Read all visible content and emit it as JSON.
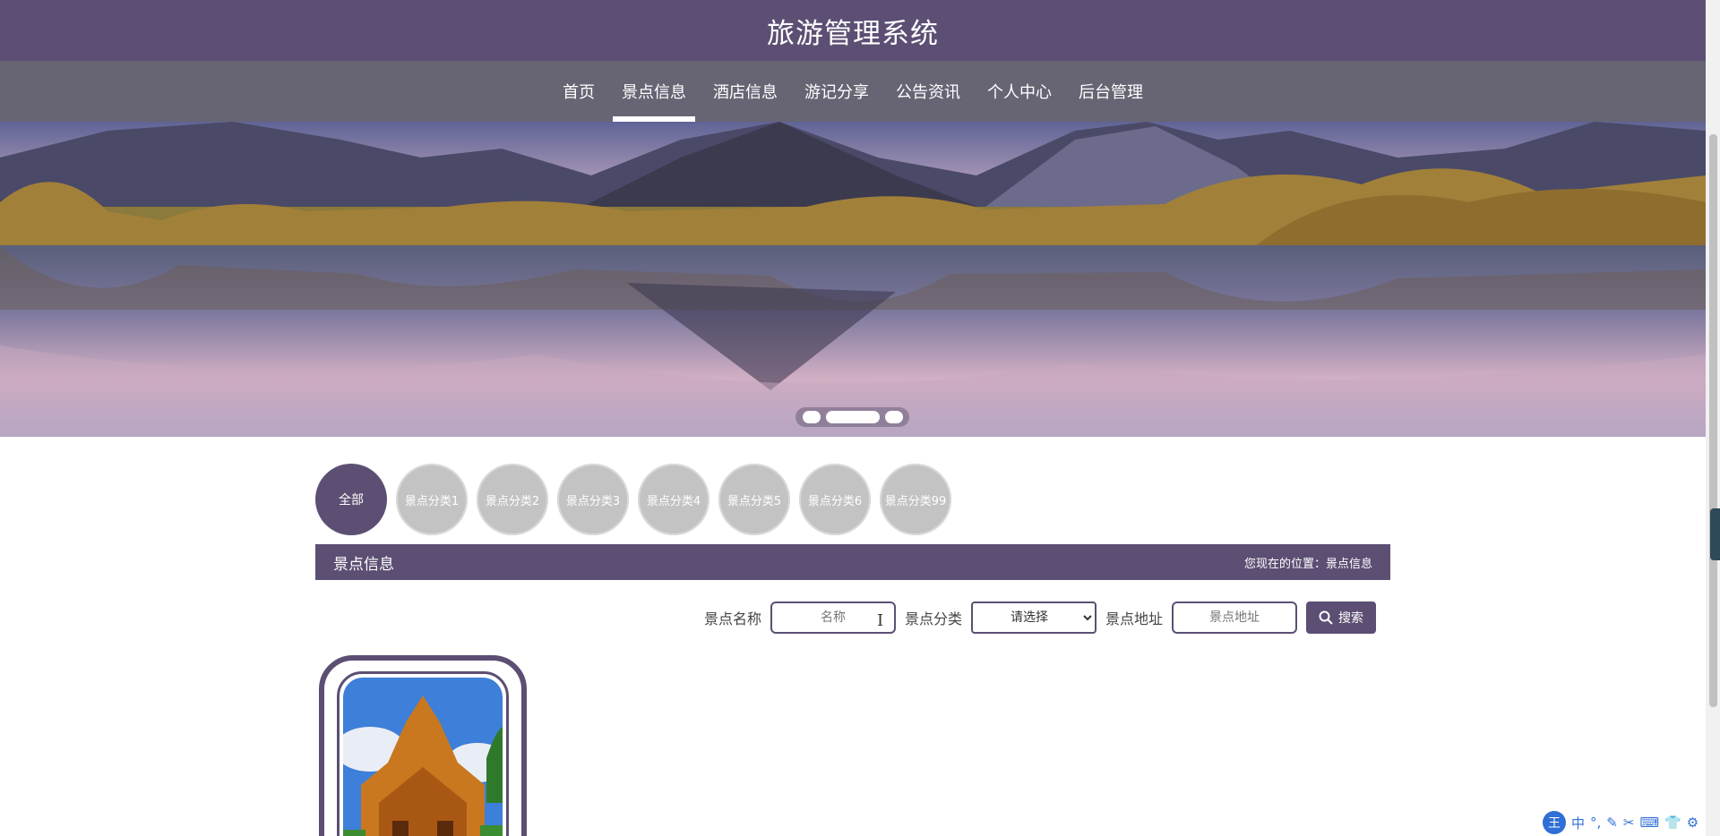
{
  "header": {
    "title": "旅游管理系统"
  },
  "nav": {
    "items": [
      {
        "label": "首页"
      },
      {
        "label": "景点信息",
        "active": true
      },
      {
        "label": "酒店信息"
      },
      {
        "label": "游记分享"
      },
      {
        "label": "公告资讯"
      },
      {
        "label": "个人中心"
      },
      {
        "label": "后台管理"
      }
    ]
  },
  "banner": {
    "slide_count": 3,
    "active_slide": 2
  },
  "categories": [
    {
      "label": "全部",
      "active": true
    },
    {
      "label": "景点分类1"
    },
    {
      "label": "景点分类2"
    },
    {
      "label": "景点分类3"
    },
    {
      "label": "景点分类4"
    },
    {
      "label": "景点分类5"
    },
    {
      "label": "景点分类6"
    },
    {
      "label": "景点分类99"
    }
  ],
  "section": {
    "title": "景点信息",
    "breadcrumb_prefix": "您现在的位置：",
    "breadcrumb_current": "景点信息"
  },
  "search": {
    "name_label": "景点名称",
    "name_placeholder": "名称",
    "category_label": "景点分类",
    "category_selected": "请选择",
    "address_label": "景点地址",
    "address_placeholder": "景点地址",
    "button_label": "搜索",
    "button_icon": "search-icon"
  },
  "ime_toolbar": {
    "logo": "王",
    "items": [
      "中",
      "°,",
      "✎",
      "✂",
      "⌨",
      "👕",
      "⚙"
    ]
  },
  "colors": {
    "primary": "#5c4f73",
    "nav_bg": "#676474",
    "category_inactive": "#c3c3c3"
  }
}
